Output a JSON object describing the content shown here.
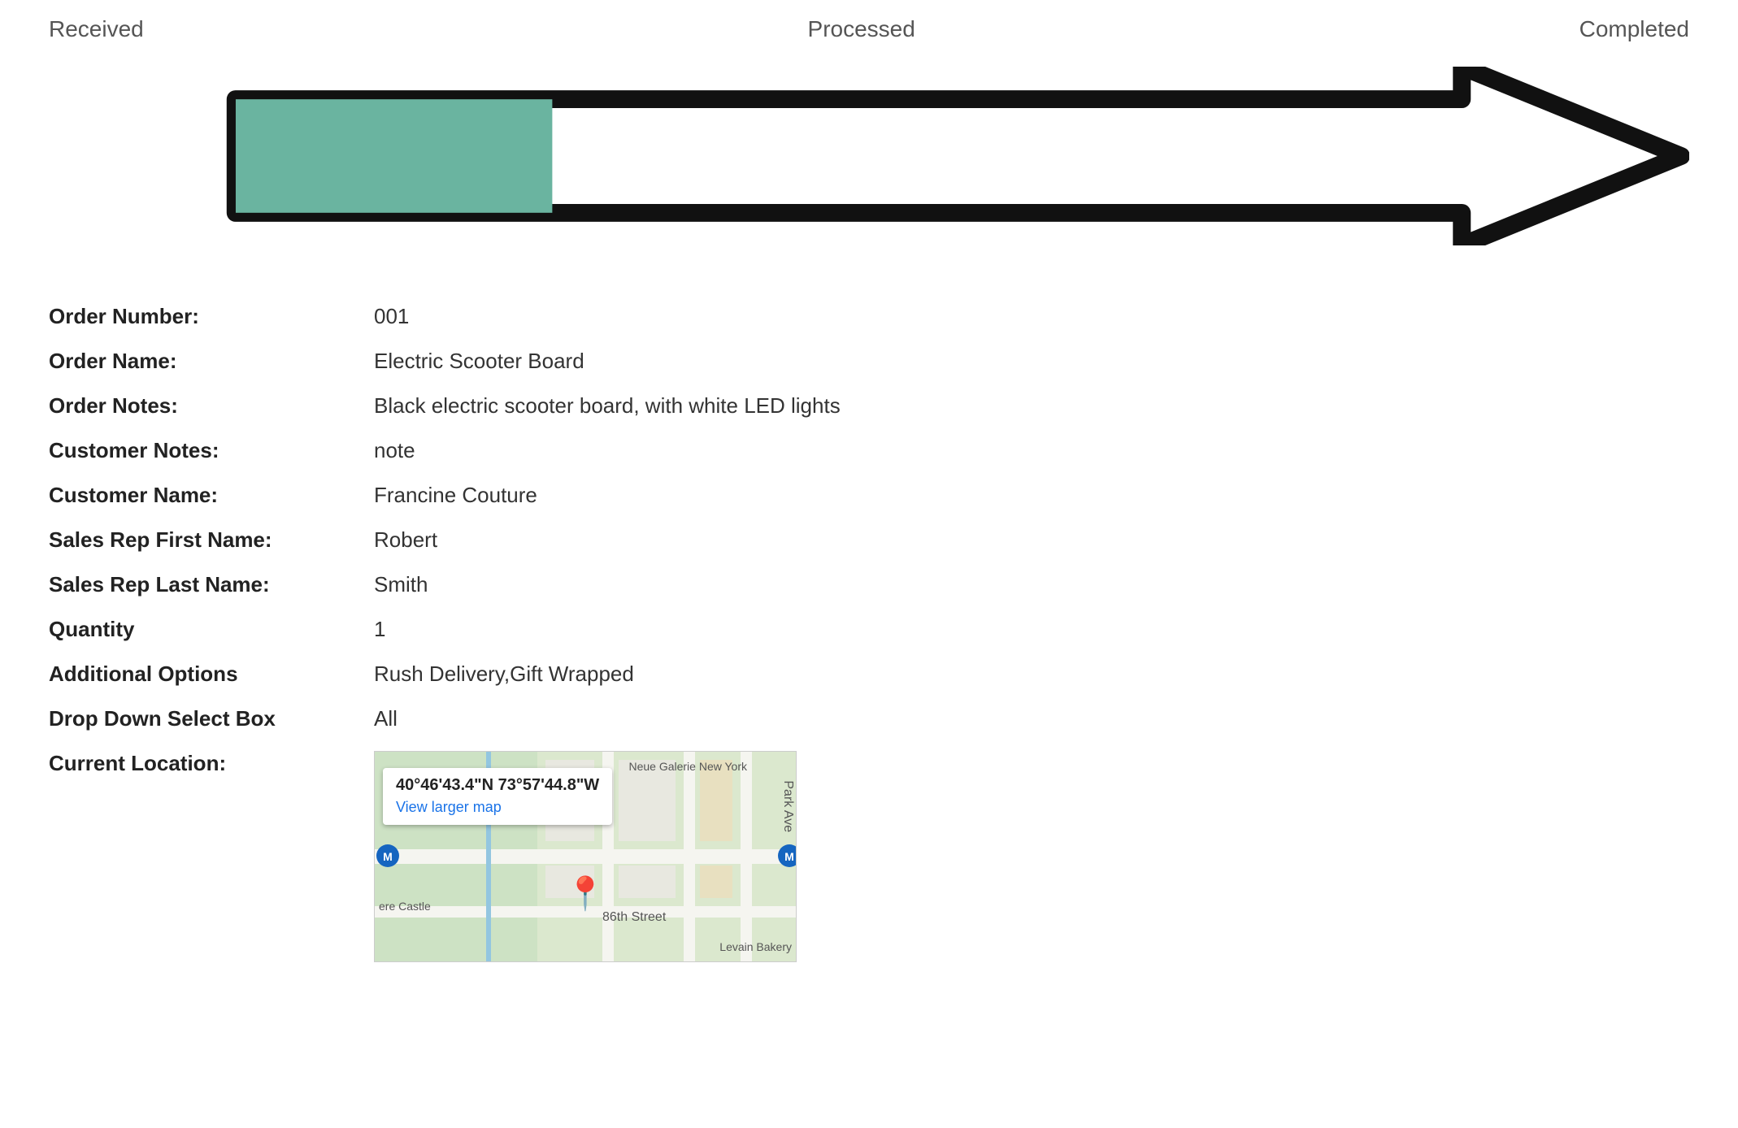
{
  "statusBar": {
    "received": "Received",
    "processed": "Processed",
    "completed": "Completed",
    "progressPercent": 25,
    "fillColor": "#6ab4a0",
    "borderColor": "#111"
  },
  "orderDetails": {
    "fields": [
      {
        "label": "Order Number:",
        "value": "001"
      },
      {
        "label": "Order Name:",
        "value": "Electric Scooter Board"
      },
      {
        "label": "Order Notes:",
        "value": "Black electric scooter board, with white LED lights"
      },
      {
        "label": "Customer Notes:",
        "value": "note"
      },
      {
        "label": "Customer Name:",
        "value": "Francine Couture"
      },
      {
        "label": "Sales Rep First Name:",
        "value": "Robert"
      },
      {
        "label": "Sales Rep Last Name:",
        "value": "Smith"
      },
      {
        "label": "Quantity",
        "value": "1"
      },
      {
        "label": "Additional Options",
        "value": "Rush Delivery,Gift Wrapped"
      },
      {
        "label": "Drop Down Select Box",
        "value": "All"
      }
    ]
  },
  "map": {
    "coordinates": "40°46'43.4\"N 73°57'44.8\"W",
    "viewLargerLabel": "View larger map",
    "streetLabel1": "86th Street",
    "streetLabel2": "Park Ave",
    "poiLabel1": "Neue Galerie New York",
    "poiLabel2": "Levain Bakery",
    "cornerLabel": "ere Castle"
  }
}
